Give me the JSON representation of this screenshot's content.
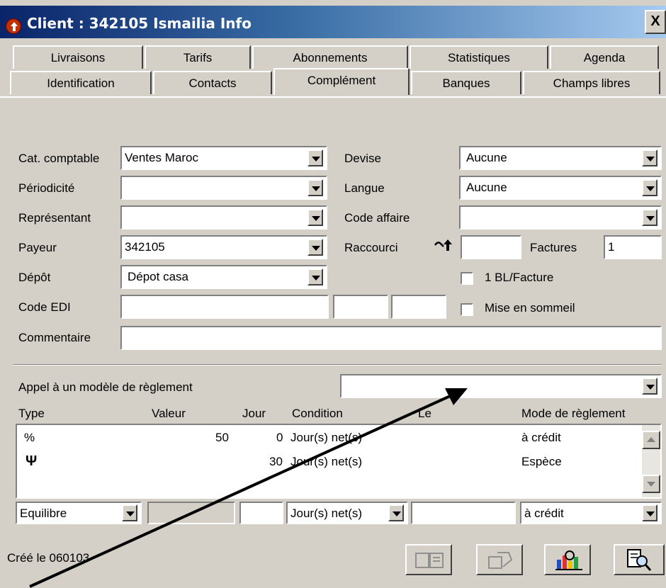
{
  "window": {
    "title": "Client : 342105 Ismailia Info",
    "close_label": "X"
  },
  "tabs_row1": [
    "Livraisons",
    "Tarifs",
    "Abonnements",
    "Statistiques",
    "Agenda"
  ],
  "tabs_row2": [
    "Identification",
    "Contacts",
    "Complément",
    "Banques",
    "Champs libres"
  ],
  "active_tab": "Complément",
  "form": {
    "cat_comptable": {
      "label": "Cat. comptable",
      "value": "Ventes Maroc"
    },
    "periodicite": {
      "label": "Périodicité",
      "value": ""
    },
    "representant": {
      "label": "Représentant",
      "value": ""
    },
    "payeur": {
      "label": "Payeur",
      "value": "342105"
    },
    "depot": {
      "label": "Dépôt",
      "value": "Dépot casa"
    },
    "code_edi": {
      "label": "Code EDI",
      "value": ""
    },
    "commentaire": {
      "label": "Commentaire",
      "value": ""
    },
    "devise": {
      "label": "Devise",
      "value": "Aucune"
    },
    "langue": {
      "label": "Langue",
      "value": "Aucune"
    },
    "code_affaire": {
      "label": "Code affaire",
      "value": ""
    },
    "raccourci": {
      "label": "Raccourci",
      "value": ""
    },
    "factures": {
      "label": "Factures",
      "value": "1"
    },
    "bl_facture": {
      "label": "1 BL/Facture",
      "checked": false
    },
    "mise_en_sommeil": {
      "label": "Mise en sommeil",
      "checked": false
    }
  },
  "reglement": {
    "modele_label": "Appel à un modèle de règlement",
    "modele_value": "",
    "columns": [
      "Type",
      "Valeur",
      "Jour",
      "Condition",
      "Le",
      "Mode de règlement"
    ],
    "rows": [
      {
        "type": "%",
        "valeur": "50",
        "jour": "0",
        "condition": "Jour(s) net(s)",
        "le": "",
        "mode": "à crédit"
      },
      {
        "type": "Ψ",
        "valeur": "",
        "jour": "30",
        "condition": "Jour(s) net(s)",
        "le": "",
        "mode": "Espèce"
      }
    ],
    "editor": {
      "type": "Equilibre",
      "valeur": "",
      "jour": "",
      "condition": "Jour(s) net(s)",
      "le": "",
      "mode": "à crédit"
    }
  },
  "status": {
    "created": "Créé le 060103"
  },
  "toolbar_icons": [
    "card-icon",
    "money-icon",
    "chart-icon",
    "search-doc-icon"
  ],
  "colors": {
    "face": "#d4d0c8",
    "title_start": "#0a246a",
    "title_end": "#a6caf0"
  }
}
